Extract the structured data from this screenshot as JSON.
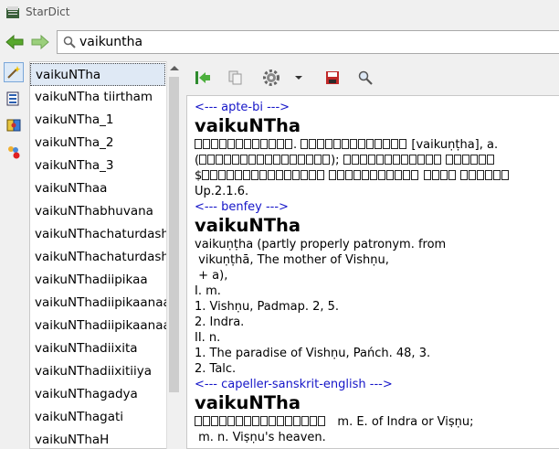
{
  "window": {
    "title": "StarDict"
  },
  "search": {
    "value": "vaikuntha"
  },
  "word_list": [
    "vaikuNTha",
    "vaikuNTha tiirtham",
    "vaikuNTha_1",
    "vaikuNTha_2",
    "vaikuNTha_3",
    "vaikuNThaa",
    "vaikuNThabhuvana",
    "vaikuNThachaturdashi",
    "vaikuNThachaturdashi",
    "vaikuNThadiipikaa",
    "vaikuNThadiipikaanaat",
    "vaikuNThadiipikaanaat",
    "vaikuNThadiixita",
    "vaikuNThadiixitiiya",
    "vaikuNThagadya",
    "vaikuNThagati",
    "vaikuNThaH"
  ],
  "article": {
    "apte": {
      "separator": "<--- apte-bi --->",
      "headword": "vaikuNTha",
      "line1_tail": "[vaikuṇṭha], a.",
      "line3_lead": "$",
      "line4": "Up.2.1.6."
    },
    "benfey": {
      "separator": "<--- benfey --->",
      "headword": "vaikuNTha",
      "lines": [
        "vaikuṇṭha (partly properly patronym. from",
        " vikuṇṭhā, The mother of Vishṇu,",
        " + a),",
        "I. m.",
        "1. Vishṇu, Padmap. 2, 5.",
        "2. Indra.",
        "II. n.",
        "1. The paradise of Vishṇu, Pańch. 48, 3.",
        "2. Talc."
      ]
    },
    "capeller": {
      "separator": "<--- capeller-sanskrit-english --->",
      "headword": "vaikuNTha",
      "line1_tail": "m. E. of Indra or Viṣṇu;",
      "line2": " m. n. Viṣṇu's heaven."
    }
  },
  "colors": {
    "separator": "#1515c8",
    "selection": "#dfe9f5"
  }
}
